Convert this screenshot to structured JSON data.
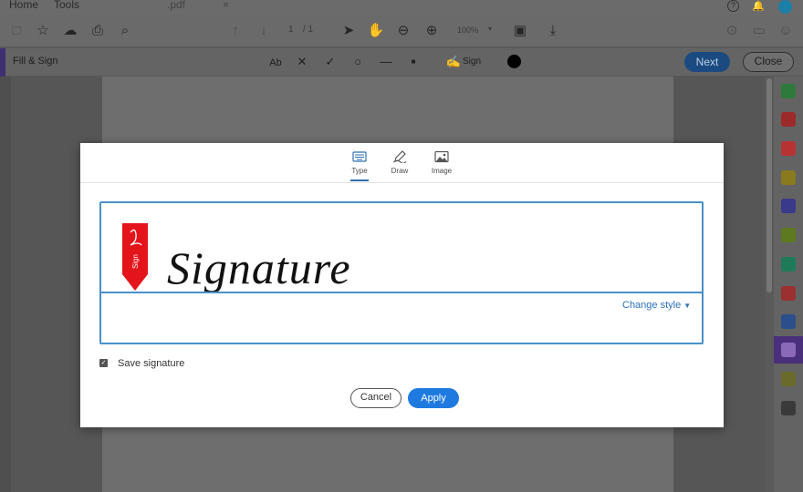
{
  "menubar": {
    "home": "Home",
    "tools": "Tools",
    "doc_tab": ".pdf",
    "tab_close": "×",
    "help": "?"
  },
  "toolbar": {
    "page_current": "1",
    "page_total": "/ 1",
    "zoom": "100%"
  },
  "fillsign": {
    "title": "Fill & Sign",
    "text_tool": "Ab",
    "sign_label": "Sign",
    "next": "Next",
    "close": "Close",
    "current_color": "#000000"
  },
  "dialog": {
    "tabs": [
      {
        "label": "Type",
        "icon": "keyboard-icon",
        "active": true
      },
      {
        "label": "Draw",
        "icon": "pen-icon",
        "active": false
      },
      {
        "label": "Image",
        "icon": "image-icon",
        "active": false
      }
    ],
    "signature_text": "Signature",
    "flag_text": "Sign",
    "change_style": "Change style",
    "save_signature_label": "Save signature",
    "save_signature_checked": true,
    "cancel": "Cancel",
    "apply": "Apply"
  },
  "colors": {
    "accent_blue": "#1f7ae0",
    "input_border": "#4a90c8",
    "flag_red": "#e4141b",
    "rail_active": "#4a2f7a"
  }
}
